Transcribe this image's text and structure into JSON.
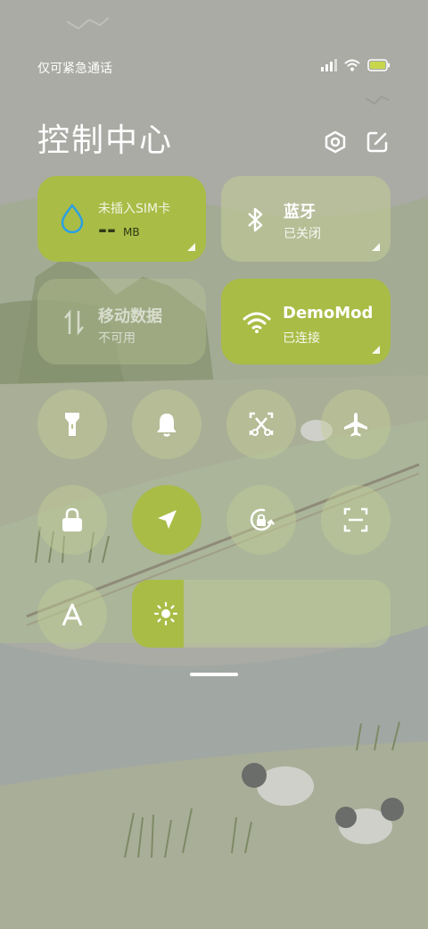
{
  "status_bar": {
    "carrier_text": "仅可紧急通话"
  },
  "header": {
    "title": "控制中心"
  },
  "tiles": {
    "data_usage": {
      "label": "未插入SIM卡",
      "value": "--",
      "unit": "MB"
    },
    "bluetooth": {
      "title": "蓝牙",
      "status": "已关闭"
    },
    "mobile_data": {
      "title": "移动数据",
      "status": "不可用"
    },
    "wifi": {
      "title": "DemoMod",
      "status": "已连接"
    }
  },
  "toggles": [
    {
      "name": "flashlight",
      "active": false
    },
    {
      "name": "bell",
      "active": false
    },
    {
      "name": "screenshot-crop",
      "active": false
    },
    {
      "name": "airplane-mode",
      "active": false
    },
    {
      "name": "lock",
      "active": false
    },
    {
      "name": "location",
      "active": true
    },
    {
      "name": "rotation-lock",
      "active": false
    },
    {
      "name": "scan",
      "active": false
    },
    {
      "name": "auto-brightness-font",
      "active": false
    }
  ],
  "brightness": {
    "level": 0.2
  },
  "colors": {
    "accent": "#a9bc46",
    "tile_faint": "#c4ce96",
    "drop_icon": "#2aa0e6"
  }
}
